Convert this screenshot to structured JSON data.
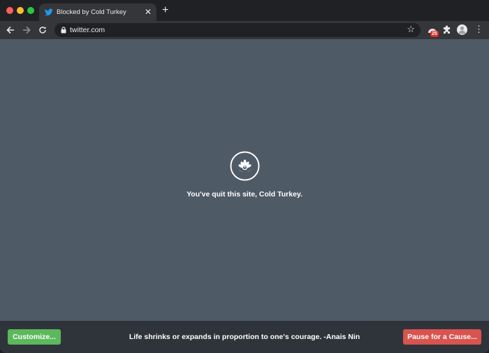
{
  "tab": {
    "title": "Blocked by Cold Turkey",
    "close_label": "✕"
  },
  "toolbar": {
    "url": "twitter.com",
    "extension_badge": "25"
  },
  "content": {
    "message": "You've quit this site, Cold Turkey."
  },
  "footer": {
    "customize_label": "Customize...",
    "quote": "Life shrinks or expands in proportion to one's courage. -Anais Nin",
    "pause_label": "Pause for a Cause..."
  },
  "colors": {
    "content_bg": "#4f5a67",
    "footer_bg": "#2f343a",
    "customize_button": "#5cb85c",
    "pause_button": "#d9534f",
    "twitter_blue": "#1d9bf0"
  },
  "icons": [
    "twitter-favicon-icon",
    "lock-icon",
    "star-icon",
    "cold-turkey-extension-icon",
    "puzzle-icon",
    "profile-avatar",
    "more-menu-icon",
    "cold-turkey-logo-icon"
  ]
}
